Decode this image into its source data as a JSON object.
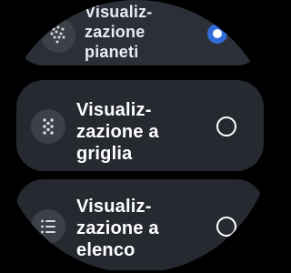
{
  "options": {
    "planets": {
      "lines": [
        "Visualiz-",
        "zazione",
        "pianeti"
      ],
      "selected": true,
      "icon": "planets-dots-icon"
    },
    "grid": {
      "lines": [
        "Visualiz-",
        "zazione a",
        "griglia"
      ],
      "selected": false,
      "icon": "grid-dots-icon"
    },
    "list": {
      "lines": [
        "Visualiz-",
        "zazione a",
        "elenco"
      ],
      "selected": false,
      "icon": "list-icon"
    }
  },
  "colors": {
    "accent": "#2f6bd9",
    "card": "#262a30",
    "icon_bg": "#3c4047"
  }
}
